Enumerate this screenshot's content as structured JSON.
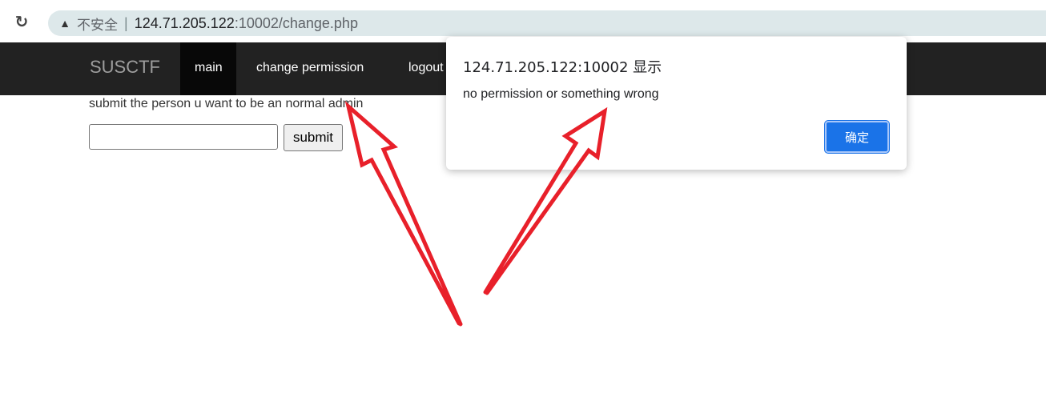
{
  "browser": {
    "security_label": "不安全",
    "url_host": "124.71.205.122",
    "url_rest": ":10002/change.php"
  },
  "navbar": {
    "brand": "SUSCTF",
    "links": [
      "main",
      "change permission",
      "logout"
    ]
  },
  "page": {
    "label": "submit the person u want to be an normal admin",
    "input_value": "",
    "submit_label": "submit"
  },
  "dialog": {
    "title": "124.71.205.122:10002 显示",
    "message": "no permission or something wrong",
    "ok_label": "确定"
  },
  "colors": {
    "navbar_bg": "#222222",
    "arrow": "#e8202a",
    "dialog_button": "#1a73e8"
  },
  "icons": [
    "reload-icon",
    "warning-icon"
  ]
}
